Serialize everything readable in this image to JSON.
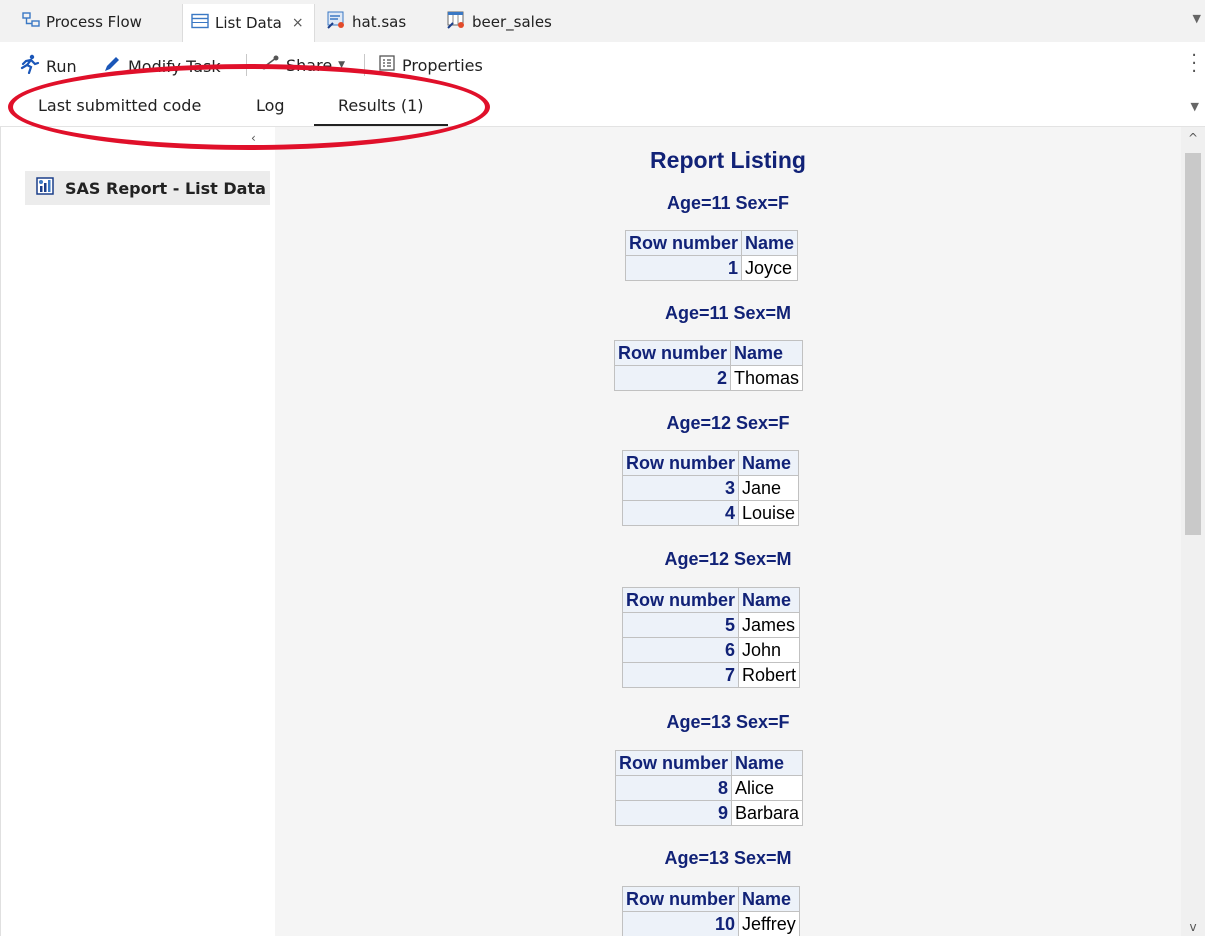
{
  "doc_tabs": [
    {
      "label": "Process Flow",
      "icon": "process-flow-icon"
    },
    {
      "label": "List Data",
      "icon": "list-data-icon",
      "active": true,
      "close": "×"
    },
    {
      "label": "hat.sas",
      "icon": "sas-program-icon"
    },
    {
      "label": "beer_sales",
      "icon": "dataset-icon"
    }
  ],
  "toolbar": {
    "run": "Run",
    "modify_task": "Modify Task",
    "share": "Share",
    "properties": "Properties"
  },
  "sub_tabs": {
    "last_submitted_code": "Last submitted code",
    "log": "Log",
    "results": "Results (1)"
  },
  "nav": {
    "item": "SAS Report - List Data"
  },
  "report": {
    "title": "Report Listing",
    "header_row_number": "Row number",
    "header_name": "Name",
    "groups": [
      {
        "label": "Age=11 Sex=F",
        "rows": [
          {
            "n": "1",
            "name": "Joyce"
          }
        ]
      },
      {
        "label": "Age=11 Sex=M",
        "rows": [
          {
            "n": "2",
            "name": "Thomas"
          }
        ]
      },
      {
        "label": "Age=12 Sex=F",
        "rows": [
          {
            "n": "3",
            "name": "Jane"
          },
          {
            "n": "4",
            "name": "Louise"
          }
        ]
      },
      {
        "label": "Age=12 Sex=M",
        "rows": [
          {
            "n": "5",
            "name": "James"
          },
          {
            "n": "6",
            "name": "John"
          },
          {
            "n": "7",
            "name": "Robert"
          }
        ]
      },
      {
        "label": "Age=13 Sex=F",
        "rows": [
          {
            "n": "8",
            "name": "Alice"
          },
          {
            "n": "9",
            "name": "Barbara"
          }
        ]
      },
      {
        "label": "Age=13 Sex=M",
        "rows": [
          {
            "n": "10",
            "name": "Jeffrey"
          }
        ]
      }
    ]
  },
  "colors": {
    "annotation": "#e0102a",
    "report_title": "#112277",
    "header_bg": "#edf2f9"
  }
}
